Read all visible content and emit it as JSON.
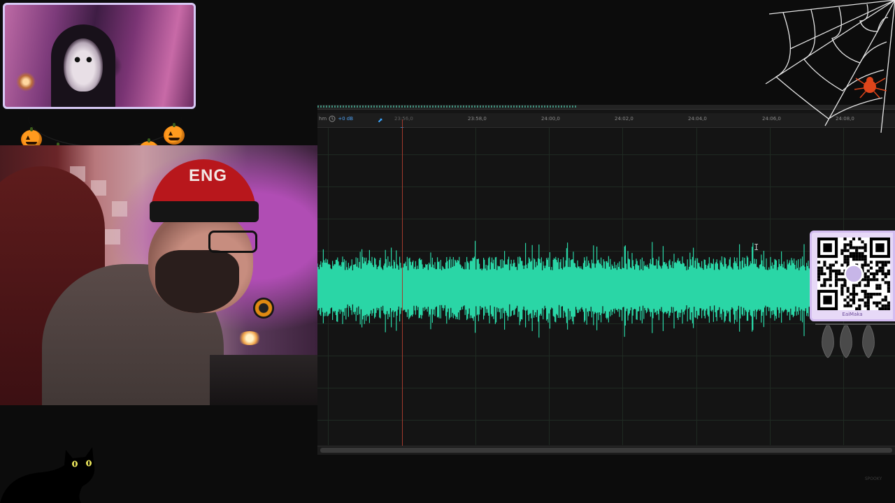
{
  "editor": {
    "ruler": {
      "ctrl_unit": "hm",
      "ctrl_gain": "+0 dB",
      "tick_labels": [
        "23:56,0",
        "23:58,0",
        "24:00,0",
        "24:02,0",
        "24:04,0",
        "24:06,0",
        "24:08,0"
      ]
    },
    "waveform_color": "#2ad6a6",
    "playhead_color": "#a33a2d"
  },
  "overlay": {
    "qr_label": "EaiMaka",
    "watermark": "SPOOKY"
  },
  "colors": {
    "pumpkin": "#ff9a1e",
    "qr_frame": "#d3bcf1",
    "cat_eyes": "#e8e35a"
  },
  "icons": [
    "clock-icon",
    "pin-icon",
    "i-beam-cursor-icon",
    "spider-web-icon",
    "spider-icon",
    "pumpkin-icon",
    "bat-icon",
    "cat-icon",
    "qr-code-icon"
  ]
}
